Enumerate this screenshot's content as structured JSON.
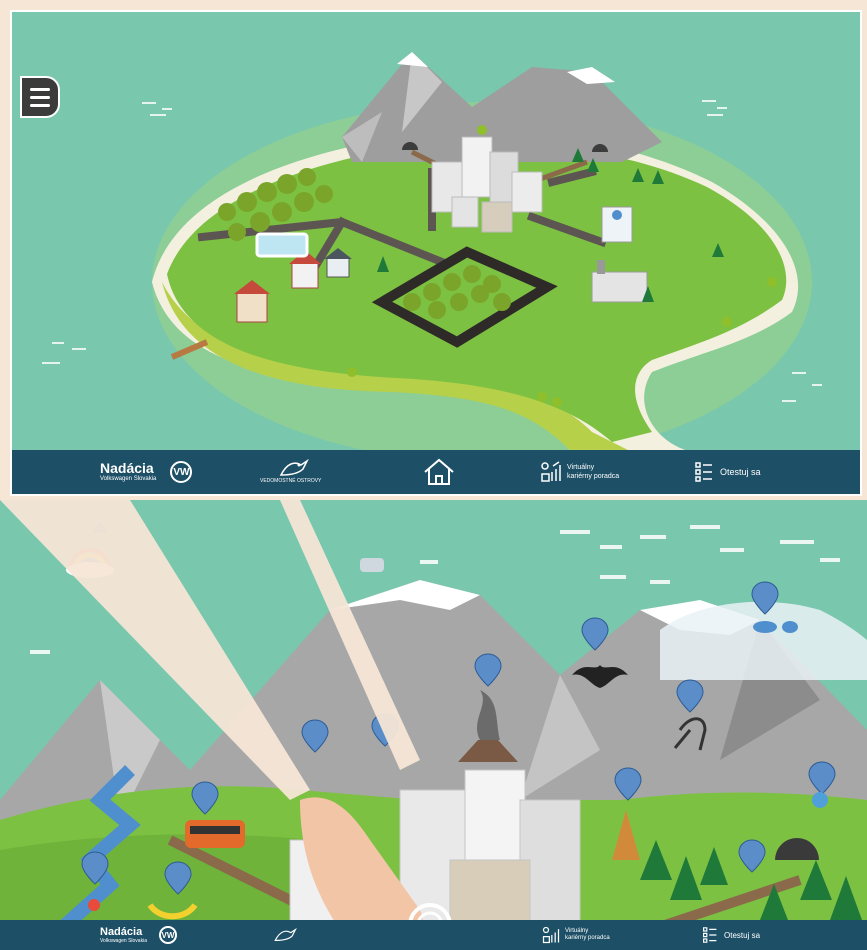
{
  "brand": {
    "name": "Nadácia",
    "subtitle": "Volkswagen Slovakia",
    "vw_mark": "VW"
  },
  "logo_island": {
    "icon": "island-bird-logo-icon",
    "caption": "VEDOMOSTNÉ OSTROVY"
  },
  "nav": {
    "home_icon": "home-icon",
    "career_advisor_line1": "Virtuálny",
    "career_advisor_line2": "kariérny poradca",
    "test_label": "Otestuj sa"
  },
  "menu": {
    "icon": "hamburger-menu-icon"
  },
  "colors": {
    "sea": "#79c7ad",
    "bar": "#1d4f66",
    "grass": "#7dc143",
    "mountain": "#9e9e9e",
    "pin": "#5b8dc9",
    "callout": "#f6e6d6"
  },
  "map_pins": [
    "rainbow-pin",
    "cauldron-pin",
    "footprint-pin",
    "bat-pin",
    "volcano-pin",
    "bird-question-pin",
    "kite-pin",
    "signpost-pin",
    "train-pin",
    "water-drop-pin",
    "tree-pin",
    "river-pin",
    "banana-pin",
    "strawberry-pin",
    "hat-pin"
  ]
}
